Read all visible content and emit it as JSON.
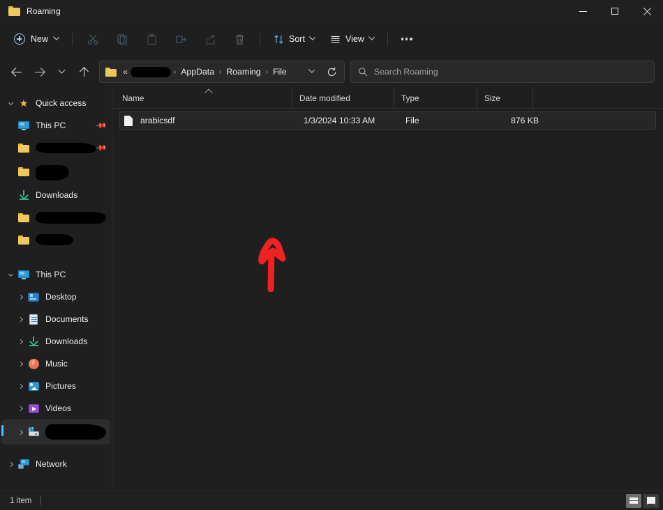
{
  "window": {
    "title": "Roaming",
    "title_icon": "folder-icon",
    "controls": {
      "minimize": "minimize-icon",
      "maximize": "maximize-icon",
      "close": "close-icon"
    }
  },
  "toolbar": {
    "new_label": "New",
    "new_icon": "plus-circle-icon",
    "actions": [
      {
        "name": "cut",
        "icon": "scissors-icon",
        "disabled": true
      },
      {
        "name": "copy",
        "icon": "copy-icon",
        "disabled": true
      },
      {
        "name": "paste",
        "icon": "clipboard-icon",
        "disabled": true
      },
      {
        "name": "rename",
        "icon": "rename-icon",
        "disabled": true
      },
      {
        "name": "share",
        "icon": "share-icon",
        "disabled": true
      },
      {
        "name": "delete",
        "icon": "trash-icon",
        "disabled": true
      }
    ],
    "sort_label": "Sort",
    "sort_icon": "sort-arrows-icon",
    "view_label": "View",
    "view_icon": "view-lines-icon",
    "more_label": "See more",
    "more_icon": "ellipsis-icon"
  },
  "navigation": {
    "back_icon": "arrow-left-icon",
    "forward_icon": "arrow-right-icon",
    "recent_icon": "chevron-down-icon",
    "up_icon": "arrow-up-icon"
  },
  "address": {
    "folder_icon": "folder-icon",
    "overflow": "«",
    "redacted_segment": "",
    "crumbs": [
      "AppData",
      "Roaming",
      "File"
    ],
    "separator": "›",
    "dropdown_icon": "chevron-down-icon",
    "refresh_icon": "refresh-icon"
  },
  "search": {
    "icon": "search-icon",
    "placeholder": "Search Roaming",
    "value": ""
  },
  "sidebar": {
    "quick_access": {
      "label": "Quick access",
      "icon": "star-icon",
      "expanded": true,
      "items": [
        {
          "label": "This PC",
          "icon": "pc-icon",
          "pinned": true,
          "redacted": false
        },
        {
          "label": "",
          "icon": "folder-icon",
          "pinned": true,
          "redacted": true,
          "blob": "blob1"
        },
        {
          "label": "",
          "icon": "folder-icon",
          "pinned": false,
          "redacted": true,
          "blob": "blob2"
        },
        {
          "label": "Downloads",
          "icon": "download-icon",
          "pinned": false,
          "redacted": false
        },
        {
          "label": "",
          "icon": "folder-icon",
          "pinned": false,
          "redacted": true,
          "blob": "blob3"
        },
        {
          "label": "",
          "icon": "folder-icon",
          "pinned": false,
          "redacted": true,
          "blob": "blob4"
        }
      ]
    },
    "this_pc": {
      "label": "This PC",
      "icon": "pc-icon",
      "expanded": true,
      "items": [
        {
          "label": "Desktop",
          "icon": "desktop-icon",
          "redacted": false,
          "selected": false
        },
        {
          "label": "Documents",
          "icon": "documents-icon",
          "redacted": false,
          "selected": false
        },
        {
          "label": "Downloads",
          "icon": "download-icon",
          "redacted": false,
          "selected": false
        },
        {
          "label": "Music",
          "icon": "music-icon",
          "redacted": false,
          "selected": false
        },
        {
          "label": "Pictures",
          "icon": "pictures-icon",
          "redacted": false,
          "selected": false
        },
        {
          "label": "Videos",
          "icon": "videos-icon",
          "redacted": false,
          "selected": false
        },
        {
          "label": "",
          "icon": "network-drive-icon",
          "redacted": true,
          "blob": "blob5",
          "selected": true
        }
      ]
    },
    "network": {
      "label": "Network",
      "icon": "network-icon",
      "expanded": false
    }
  },
  "columns": [
    {
      "label": "Name",
      "sorted": "ascending"
    },
    {
      "label": "Date modified",
      "sorted": ""
    },
    {
      "label": "Type",
      "sorted": ""
    },
    {
      "label": "Size",
      "sorted": ""
    }
  ],
  "files": [
    {
      "name": "arabicsdf",
      "date_modified": "1/3/2024 10:33 AM",
      "type": "File",
      "size": "876 KB",
      "icon": "file-icon",
      "selected": true
    }
  ],
  "annotation": {
    "type": "arrow",
    "direction": "up",
    "color": "#ee2222",
    "points_to": "arabicsdf"
  },
  "statusbar": {
    "item_count": "1 item",
    "details_view_icon": "details-view-icon",
    "large_icons_view_icon": "large-icons-view-icon",
    "active_view": "details"
  }
}
